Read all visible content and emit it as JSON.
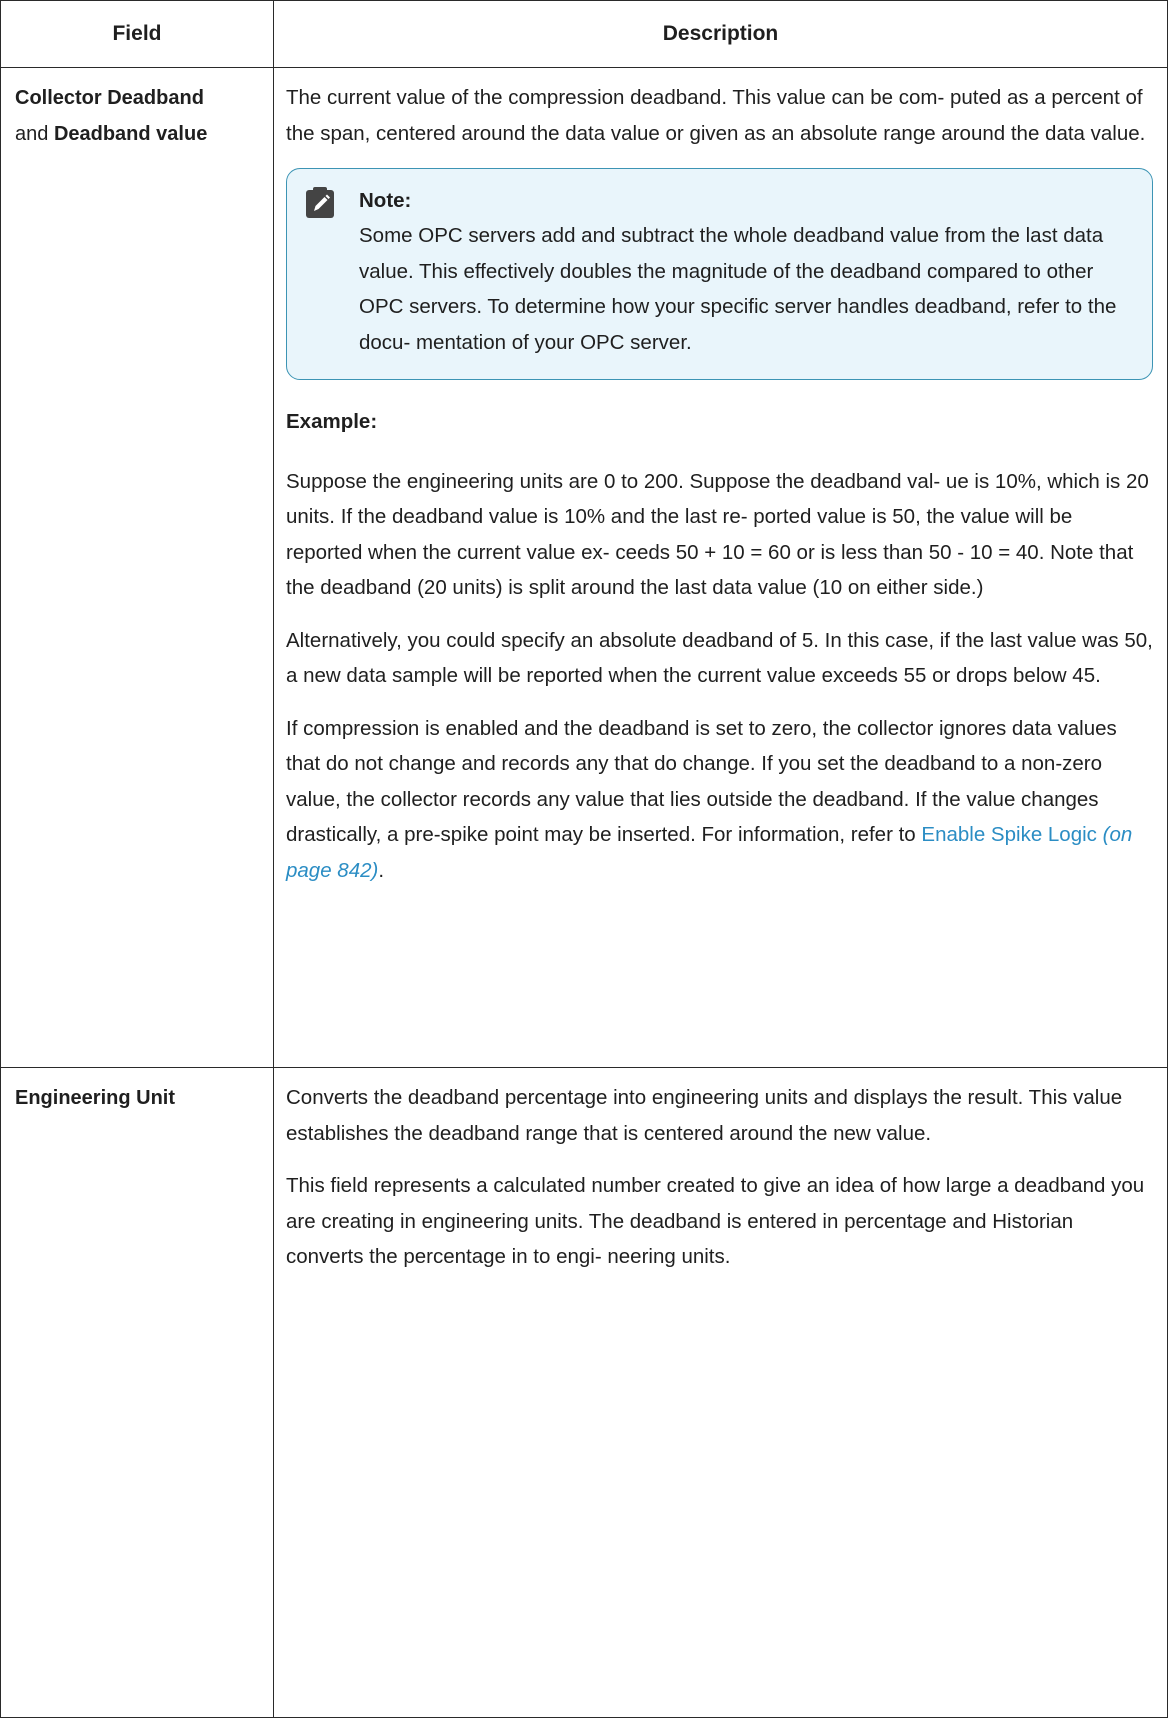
{
  "table": {
    "headers": {
      "field": "Field",
      "description": "Description"
    },
    "row1": {
      "field_part1": "Collector Deadband",
      "field_and": "and",
      "field_part2": "Deadband value",
      "intro": "The current value of the compression deadband. This value can be com- puted as a percent of the span, centered around the data value or given as an absolute range around the data value.",
      "note": {
        "icon": "pencil-note-icon",
        "title": "Note:",
        "text": "Some OPC servers add and subtract the whole deadband value from the last data value. This effectively doubles the magnitude of the deadband compared to other OPC servers. To determine how your specific server handles deadband, refer to the docu- mentation of your OPC server."
      },
      "example_title": "Example:",
      "example_p1": "Suppose the engineering units are 0 to 200. Suppose the deadband val- ue is 10%, which is 20 units. If the deadband value is 10% and the last re- ported value is 50, the value will be reported when the current value ex- ceeds 50 + 10 = 60 or is less than 50 - 10 = 40. Note that the deadband (20 units) is split around the last data value (10 on either side.)",
      "example_p2": "Alternatively, you could specify an absolute deadband of 5. In this case, if the last value was 50, a new data sample will be reported when the current value exceeds 55 or drops below 45.",
      "example_p3_text": "If compression is enabled and the deadband is set to zero, the collector ignores data values that do not change and records any that do change. If you set the deadband to a non-zero value, the collector records any value that lies outside the deadband. If the value changes drastically, a pre-spike point may be inserted. For information, refer to",
      "link_text": "Enable Spike Logic",
      "link_page": "(on page 842)",
      "period": "."
    },
    "row2": {
      "field": "Engineering Unit",
      "p1": "Converts the deadband percentage into engineering units and displays the result. This value establishes the deadband range that is centered around the new value.",
      "p2": "This field represents a calculated number created to give an idea of how large a deadband you are creating in engineering units. The deadband is entered in percentage and Historian converts the percentage in to engi- neering units."
    }
  },
  "colors": {
    "note_border": "#3c94b4",
    "note_background": "#e9f5fb",
    "link": "#2b8dc4"
  }
}
